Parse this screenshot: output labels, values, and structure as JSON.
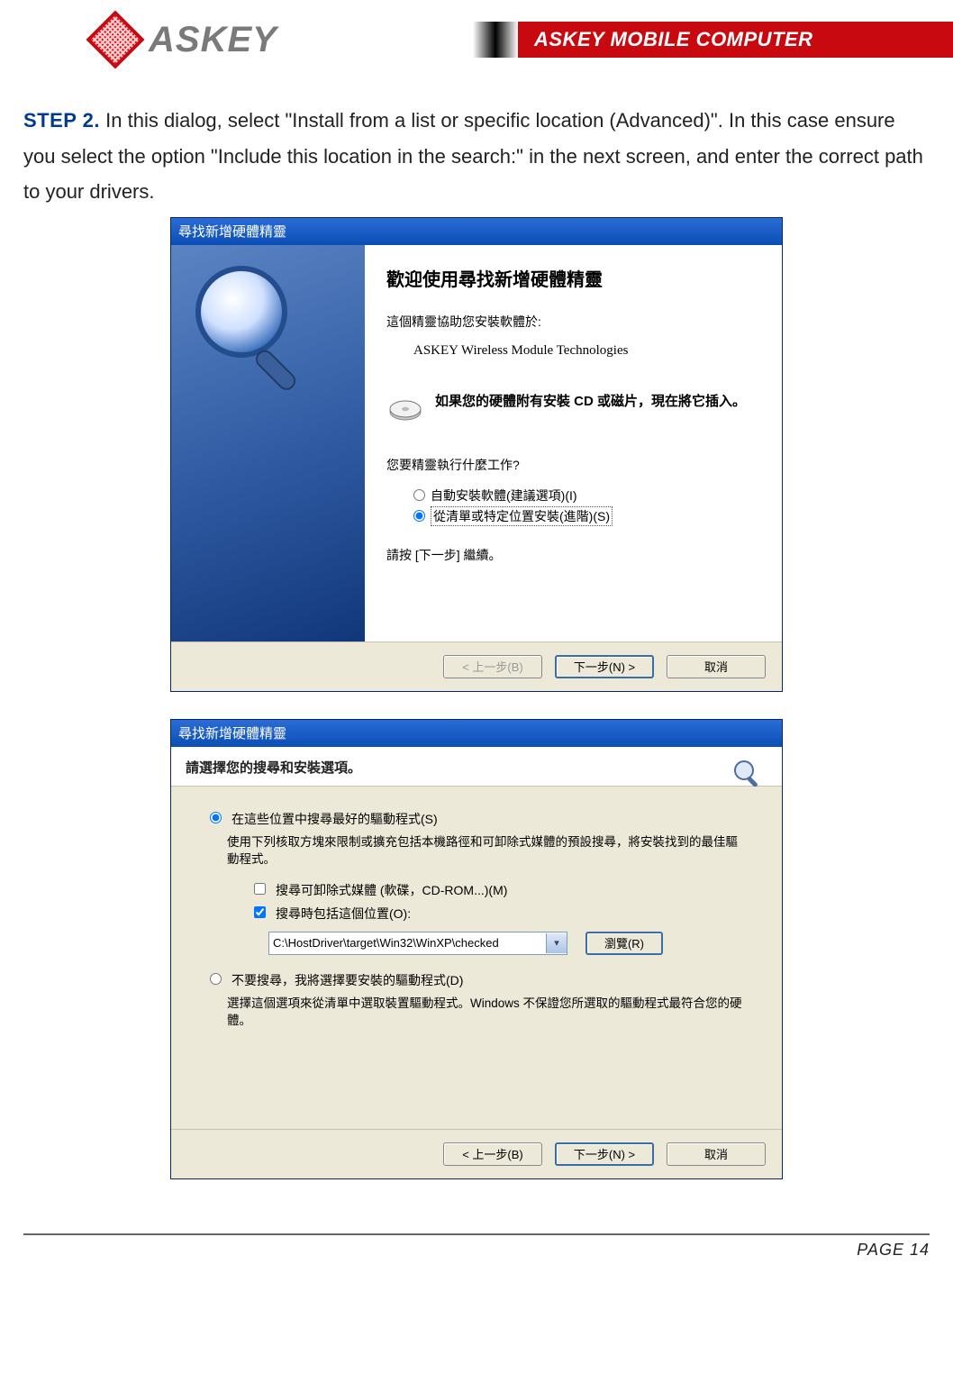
{
  "header": {
    "brand_word": "ASKEY",
    "brand_banner": "ASKEY MOBILE COMPUTER"
  },
  "instruction": {
    "step_label": "STEP 2.",
    "text": " In this dialog, select \"Install from a list or specific location (Advanced)\". In this case ensure you select the option \"Include this location in the search:\" in the next screen, and enter the correct path to your drivers."
  },
  "dlg1": {
    "title": "尋找新增硬體精靈",
    "welcome": "歡迎使用尋找新增硬體精靈",
    "helps_line": "這個精靈協助您安裝軟體於:",
    "device_name": "ASKEY Wireless Module Technologies",
    "cd_line_strong": "如果您的硬體附有安裝 CD 或磁片，現在將它插入。",
    "question": "您要精靈執行什麼工作?",
    "opt_auto": "自動安裝軟體(建議選項)(I)",
    "opt_adv": "從清單或特定位置安裝(進階)(S)",
    "continue_hint": "請按 [下一步] 繼續。",
    "btn_back": "< 上一步(B)",
    "btn_next": "下一步(N) >",
    "btn_cancel": "取消"
  },
  "dlg2": {
    "title": "尋找新增硬體精靈",
    "header": "請選擇您的搜尋和安裝選項。",
    "opt_search": "在這些位置中搜尋最好的驅動程式(S)",
    "opt_search_desc": "使用下列核取方塊來限制或擴充包括本機路徑和可卸除式媒體的預設搜尋，將安裝找到的最佳驅動程式。",
    "chk_removable": "搜尋可卸除式媒體 (軟碟，CD-ROM...)(M)",
    "chk_include": "搜尋時包括這個位置(O):",
    "path_value": "C:\\HostDriver\\target\\Win32\\WinXP\\checked",
    "btn_browse": "瀏覽(R)",
    "opt_nosrch": "不要搜尋，我將選擇要安裝的驅動程式(D)",
    "opt_nosrch_desc": "選擇這個選項來從清單中選取裝置驅動程式。Windows 不保證您所選取的驅動程式最符合您的硬體。",
    "btn_back": "< 上一步(B)",
    "btn_next": "下一步(N) >",
    "btn_cancel": "取消"
  },
  "footer": {
    "page": "PAGE 14"
  }
}
